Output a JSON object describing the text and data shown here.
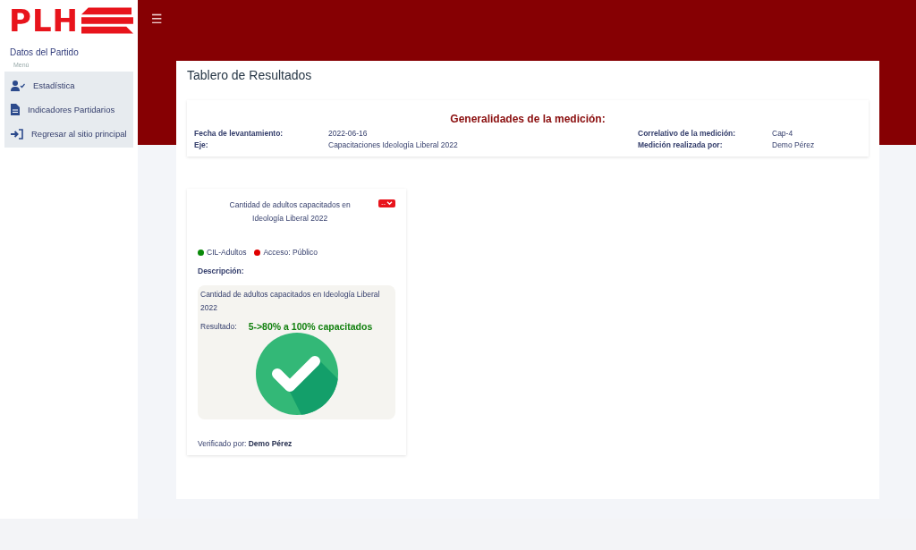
{
  "sidebar": {
    "logo": "PLH",
    "subtitle": "Datos del Partido",
    "menu_label": "Menú",
    "items": [
      {
        "label": "Estadística"
      },
      {
        "label": "Indicadores Partidarios"
      },
      {
        "label": "Regresar al sitio principal"
      }
    ]
  },
  "header": {
    "menu_icon": "☰"
  },
  "page": {
    "title": "Tablero de Resultados",
    "summary": {
      "heading": "Generalidades de la medición:",
      "left": [
        {
          "label": "Fecha de levantamiento:",
          "value": "2022-06-16"
        },
        {
          "label": "Eje:",
          "value": "Capacitaciones Ideología Liberal 2022"
        }
      ],
      "right": [
        {
          "label": "Correlativo de la medición:",
          "value": "Cap-4"
        },
        {
          "label": "Medición realizada por:",
          "value": "Demo Pérez"
        }
      ]
    },
    "indicator": {
      "title": "Cantidad de adultos capacitados en Ideología Liberal 2022",
      "dropdown": "--",
      "tags": [
        {
          "label": "CIL-Adultos",
          "color": "#0a8a0a"
        },
        {
          "label": "Acceso: Público",
          "color": "#e00000"
        }
      ],
      "description_label": "Descripción:",
      "description": "Cantidad de adultos capacitados en Ideología Liberal 2022",
      "result_label": "Resultado:",
      "result": "5->80% a 100% capacitados",
      "verified": "Verificado por: **Demo Pérez**"
    }
  }
}
